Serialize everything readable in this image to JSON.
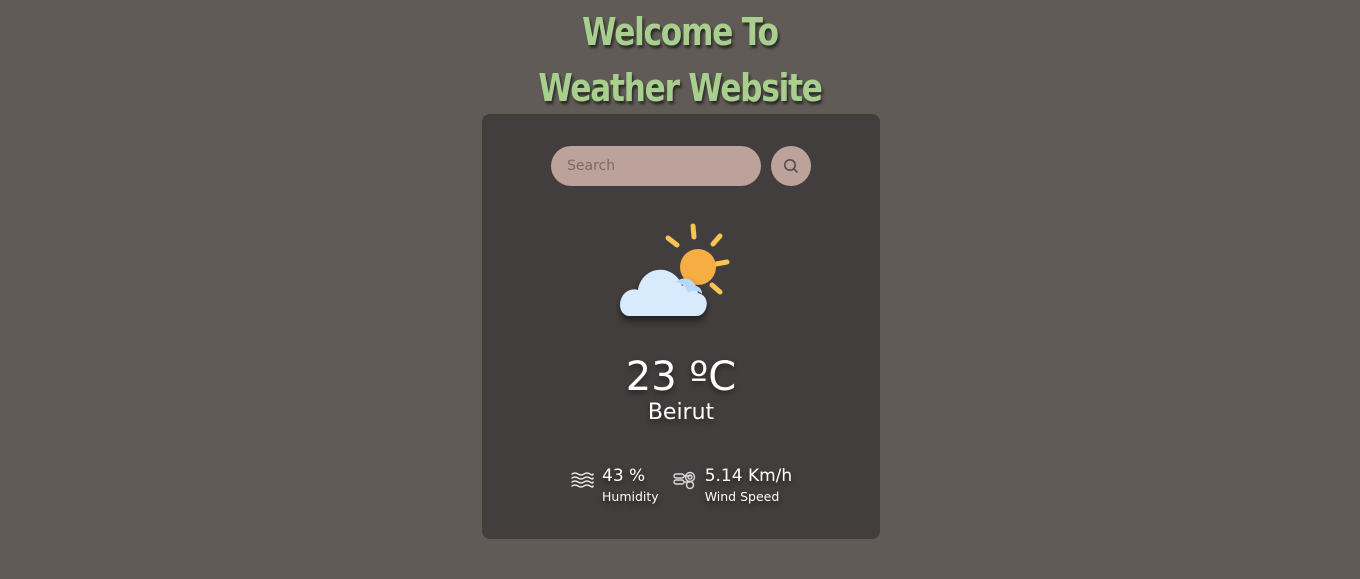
{
  "header": {
    "title": "Welcome To Weather Website"
  },
  "search": {
    "placeholder": "Search",
    "value": "",
    "button_icon": "search-icon"
  },
  "weather": {
    "icon": "partly-cloudy-icon",
    "temperature": "23 ºC",
    "city": "Beirut"
  },
  "details": {
    "humidity": {
      "icon": "humidity-icon",
      "value": "43 %",
      "label": "Humidity"
    },
    "wind": {
      "icon": "wind-icon",
      "value": "5.14 Km/h",
      "label": "Wind Speed"
    }
  },
  "colors": {
    "background": "#605b57",
    "card": "#433e3e",
    "title": "#a9cf8e",
    "input": "#bda29b",
    "sun": "#f6ad43",
    "sun_rays": "#fbc254",
    "cloud": "#d7ebfc"
  }
}
